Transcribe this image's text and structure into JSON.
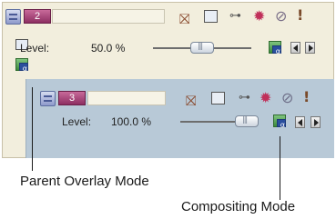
{
  "parent_track": {
    "number": "2",
    "level_label": "Level:",
    "level_value": "50.0 %",
    "level_fraction": 0.5,
    "icons": [
      "remove-fx-icon",
      "track-motion-icon",
      "chain-icon",
      "fx-icon",
      "bypass-icon",
      "exclamation-icon"
    ]
  },
  "child_track": {
    "number": "3",
    "level_label": "Level:",
    "level_value": "100.0 %",
    "level_fraction": 1.0,
    "icons": [
      "remove-fx-icon",
      "track-motion-icon",
      "chain-icon",
      "fx-icon",
      "bypass-icon",
      "exclamation-icon"
    ]
  },
  "captions": {
    "parent_overlay": "Parent Overlay Mode",
    "compositing": "Compositing Mode"
  },
  "colors": {
    "parent_panel": "#f2eedd",
    "child_panel": "#b8c9d7",
    "track_number_bg": "#a8467c"
  }
}
